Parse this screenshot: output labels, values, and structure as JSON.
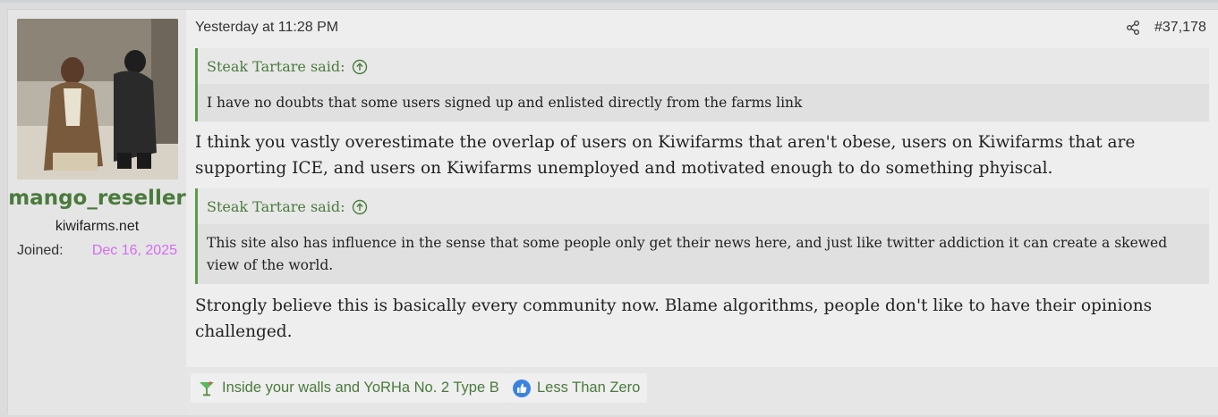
{
  "post": {
    "date": "Yesterday at 11:28 PM",
    "number": "#37,178"
  },
  "user": {
    "name": "mango_reseller",
    "title": "kiwifarms.net",
    "joined_label": "Joined:",
    "joined_value": "Dec 16, 2025"
  },
  "quotes": [
    {
      "author": "Steak Tartare said:",
      "text": "I have no doubts that some users signed up and enlisted directly from the farms link"
    },
    {
      "author": "Steak Tartare said:",
      "text": "This site also has influence in the sense that some people only get their news here, and just like twitter addiction it can create a skewed view of the world."
    }
  ],
  "messages": [
    "I think you vastly overestimate the overlap of users on Kiwifarms that aren't obese, users on Kiwifarms that are supporting ICE, and users on Kiwifarms unemployed and motivated enough to do something phyiscal.",
    "Strongly believe this is basically every community now. Blame algorithms, people don't like to have their opinions challenged."
  ],
  "reactions": [
    {
      "icon": "cocktail-icon",
      "label": "Inside your walls and YoRHa No. 2 Type B"
    },
    {
      "icon": "thumbs-up-icon",
      "label": "Less Than Zero"
    }
  ],
  "colors": {
    "accent_green": "#4a7a3c",
    "joined_date": "#d36cf0",
    "quote_border": "#5e9a4a"
  }
}
